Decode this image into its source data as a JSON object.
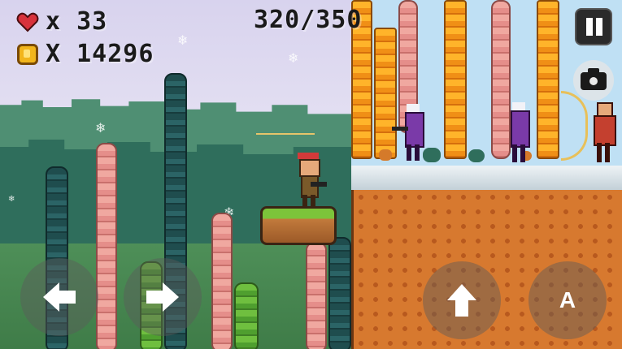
{
  "hud": {
    "lives_text": "x 33",
    "coins_text": "X 14296",
    "progress_text": "320/350",
    "progress": {
      "current": 320,
      "total": 350
    }
  },
  "icons": {
    "heart": "heart-icon",
    "coin": "coin-icon",
    "pause": "pause-icon",
    "camera": "camera-icon",
    "left": "arrow-left-icon",
    "right": "arrow-right-icon",
    "jump": "arrow-up-icon"
  },
  "controls": {
    "action_label": "A"
  },
  "colors": {
    "heart": "#d8323c",
    "coin": "#f2b51c",
    "hud_text": "#1a1a1a",
    "ground": "#d7792f",
    "grass": "#7cc43a"
  }
}
